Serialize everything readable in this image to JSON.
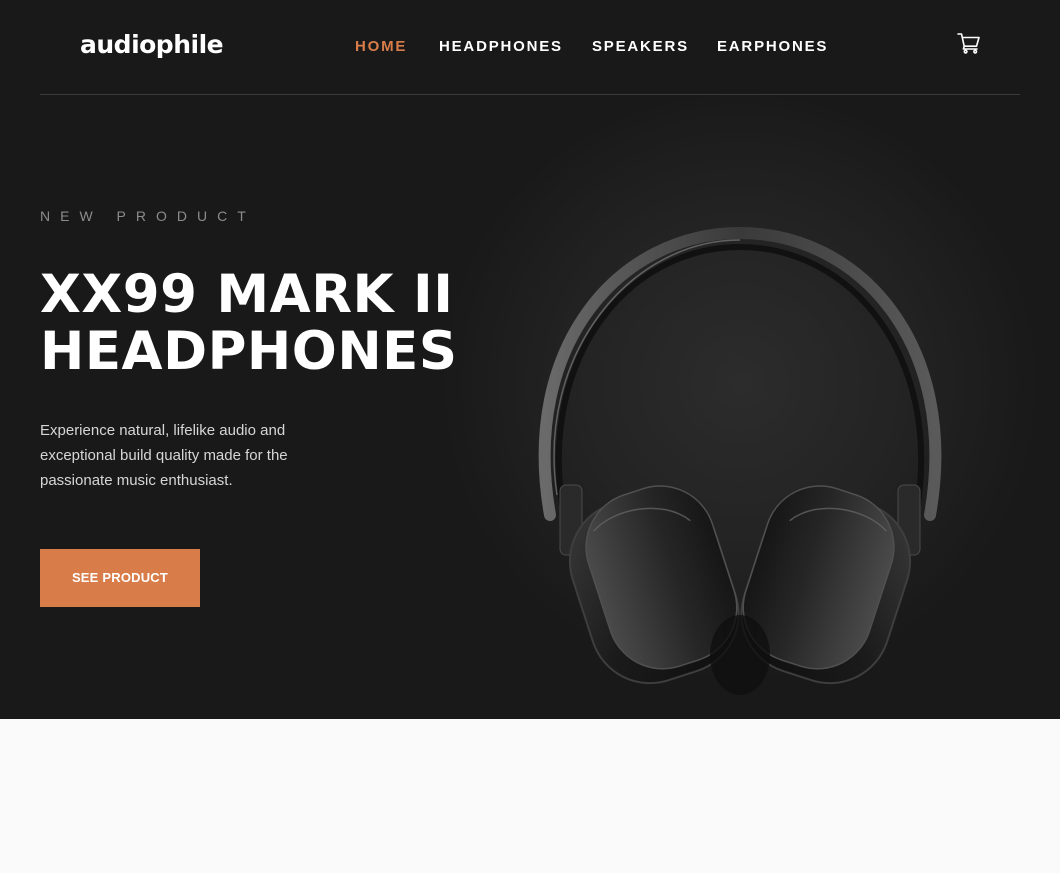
{
  "brand": {
    "logo": "audiophile",
    "accent_color": "#d87d4a",
    "hero_background": "#191919",
    "page_background": "#fafafa"
  },
  "nav": {
    "items": [
      {
        "label": "HOME",
        "active": true
      },
      {
        "label": "HEADPHONES",
        "active": false
      },
      {
        "label": "SPEAKERS",
        "active": false
      },
      {
        "label": "EARPHONES",
        "active": false
      }
    ],
    "cart_icon": "cart-icon"
  },
  "hero": {
    "overline": "NEW PRODUCT",
    "title_line1": "XX99 MARK II",
    "title_line2": "HEADPHONES",
    "description": "Experience natural, lifelike audio and exceptional build quality made for the passionate music enthusiast.",
    "cta_label": "SEE PRODUCT",
    "image": "headphones-image"
  }
}
